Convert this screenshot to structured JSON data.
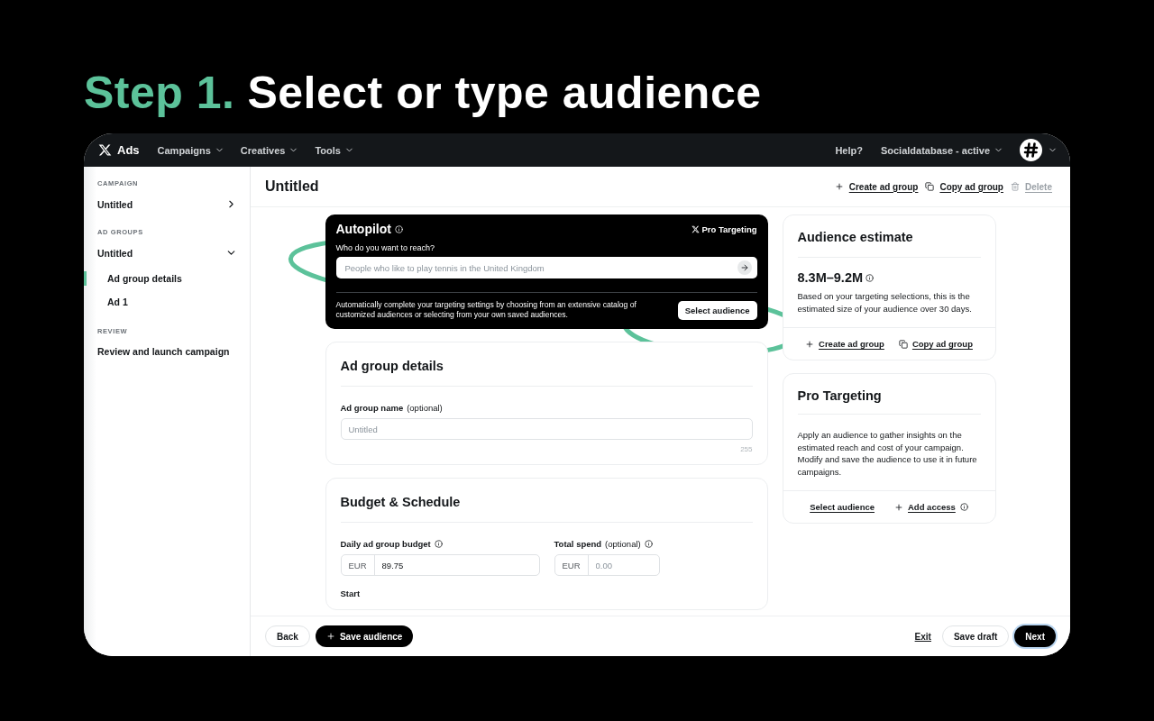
{
  "headline": {
    "step": "Step 1.",
    "title": "Select or type audience"
  },
  "topbar": {
    "brand": "Ads",
    "menus": [
      {
        "label": "Campaigns"
      },
      {
        "label": "Creatives"
      },
      {
        "label": "Tools"
      }
    ],
    "help": "Help?",
    "account": "Socialdatabase - active"
  },
  "sidebar": {
    "sections": [
      {
        "heading": "CAMPAIGN",
        "items": [
          {
            "label": "Untitled",
            "kind": "group",
            "expanded": false
          }
        ]
      },
      {
        "heading": "AD GROUPS",
        "items": [
          {
            "label": "Untitled",
            "kind": "group",
            "expanded": true,
            "children": [
              {
                "label": "Ad group details",
                "selected": true
              },
              {
                "label": "Ad 1",
                "selected": false
              }
            ]
          }
        ]
      },
      {
        "heading": "REVIEW",
        "items": [
          {
            "label": "Review and launch campaign",
            "kind": "link"
          }
        ]
      }
    ]
  },
  "page_header": {
    "title": "Untitled",
    "actions": [
      {
        "label": "Create ad group",
        "kind": "plus",
        "disabled": false
      },
      {
        "label": "Copy ad group",
        "kind": "copy",
        "disabled": false
      },
      {
        "label": "Delete",
        "kind": "trash",
        "disabled": true
      }
    ]
  },
  "autopilot": {
    "title": "Autopilot",
    "badge": "Pro Targeting",
    "question": "Who do you want to reach?",
    "placeholder": "People who like to play tennis in the United Kingdom",
    "description": "Automatically complete your targeting settings by choosing from an extensive catalog of customized audiences or selecting from your own saved audiences.",
    "button": "Select audience"
  },
  "ad_group_details": {
    "title": "Ad group details",
    "field_label": "Ad group name",
    "field_hint": "(optional)",
    "placeholder": "Untitled",
    "counter": "255"
  },
  "budget": {
    "title": "Budget & Schedule",
    "fields": [
      {
        "label": "Daily ad group budget",
        "currency": "EUR",
        "value": "89.75"
      },
      {
        "label": "Total spend",
        "hint": "(optional)",
        "currency": "EUR",
        "placeholder": "0.00"
      }
    ],
    "next_label": "Start"
  },
  "audience_estimate": {
    "title": "Audience estimate",
    "range": "8.3M–9.2M",
    "description": "Based on your targeting selections, this is the estimated size of your audience over 30 days.",
    "actions": [
      {
        "label": "Create ad group",
        "kind": "plus"
      },
      {
        "label": "Copy ad group",
        "kind": "copy"
      }
    ]
  },
  "pro_targeting": {
    "title": "Pro Targeting",
    "description": "Apply an audience to gather insights on the estimated reach and cost of your campaign. Modify and save the audience to use it in future campaigns.",
    "actions": [
      {
        "label": "Select audience",
        "kind": "link"
      },
      {
        "label": "Add access",
        "kind": "plus-info"
      }
    ]
  },
  "footer": {
    "left": [
      {
        "label": "Back",
        "kind": "outline"
      },
      {
        "label": "Save audience",
        "kind": "primary-plus"
      }
    ],
    "right": [
      {
        "label": "Exit",
        "kind": "link"
      },
      {
        "label": "Save draft",
        "kind": "outline"
      },
      {
        "label": "Next",
        "kind": "primary"
      }
    ]
  }
}
